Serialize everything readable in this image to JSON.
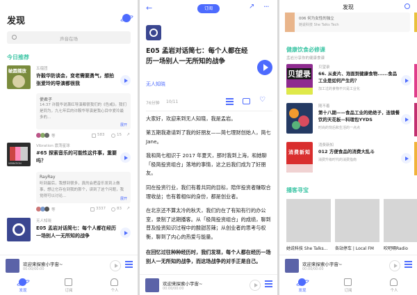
{
  "panel1": {
    "title": "发现",
    "search_placeholder": "声音在场",
    "section_title": "今日推荐",
    "cards": [
      {
        "source": "五蕴团",
        "episode_title": "许毅华防谈会，变老需要勇气，想拍张爱玲的导演都很我",
        "comment_user": "使君子",
        "comment_text": "14:37 许毅华说萧红导演都很我们的《色戒》。我们是同为，九七年后的许鞍华导演是我心目中爱玲最多的...",
        "likes": "583",
        "chats": "15",
        "more": "展开"
      },
      {
        "source": "Vibration 震荡星球",
        "episode_title": "#65 探索音乐的可能性这件事，重要吗？",
        "comment_user": "RayRay",
        "comment_text": "听到最后，我想到很多，真的会把音乐发到上做事，想让它存在到我的那个，读到了这个问题，我觉得可以讨论...",
        "likes": "3337",
        "chats": "83",
        "more": "展开"
      },
      {
        "source": "无人知晓",
        "episode_title": "E05 孟岩对话简七：每个人都在经历一场别人一无所知的战争"
      }
    ]
  },
  "mini_player": {
    "title": "欢迎来探索小宇宙~",
    "time": "00:00/00:00"
  },
  "tabs": [
    "发现",
    "订阅",
    "个人"
  ],
  "panel2": {
    "subscribe_label": "订阅",
    "episode_title": "E05 孟岩对话简七：每个人都在经历一场别人一无所知的战争",
    "podcast_name": "无人知晓",
    "duration": "76分钟",
    "date": "10/11",
    "paragraphs": [
      "大家好，欢迎来到无人知晓，我是孟岩。",
      "第五期我邀请到了我的好朋友——简七理财创始人，简七 Jane。",
      "我和简七相识于 2017 年夏天，那时我到上海，和她聊「极简投资组合」落地的事情，这之后我们成为了好朋友。",
      "同在投资行业，我们有着共同的目标，陪伴投资者赚取合理收益；也有着相似的身份，都是创业者。",
      "在北京还不算太冷的秋天，我们约在了有知有行的办公室，录制了这期播客。从「极简投资组合」的成绩，聊到普及投资知识过程中的酸甜苦辣；从创业者的思考与权衡，聊到了内心的热爱与能量。",
      "在回忆过往种种经历时，我们发现，每个人都在经历一场别人一无所知的战争，而这场战争的对手正是自己。"
    ]
  },
  "panel3": {
    "title": "发现",
    "top_item": {
      "episode": "006 何为女性的独立",
      "source": "她说科技 She Talks Tech"
    },
    "section1_title": "健康饮食必修课",
    "section1_sub": "孟岩分享你的健康食谱",
    "items": [
      {
        "source": "贝望录",
        "title": "66. 从麦片、泡面到健康食物......食品工业是如何产生的？",
        "meta": "加工过的食物不只是工业化",
        "cover_text": "贝望录"
      },
      {
        "source": "随不着",
        "title": "第十八期——食品工业的绝绝子，连锁餐饮的天花板—科理包YYDS",
        "meta": "时尚的背后和生活的一点点"
      },
      {
        "source": "消费新知",
        "title": "012 方便食品的消费大乱斗",
        "meta": "消费升级时代的消费指南",
        "cover_text": "消费新知"
      }
    ],
    "section2_title": "播客寻宝",
    "podcasts": [
      "她说科技 She Talks...",
      "各站停车 | Local FM",
      "吹吧嗝Radio"
    ]
  },
  "colors": {
    "accent": "#4d6bfe",
    "section": "#3fc6a6"
  }
}
